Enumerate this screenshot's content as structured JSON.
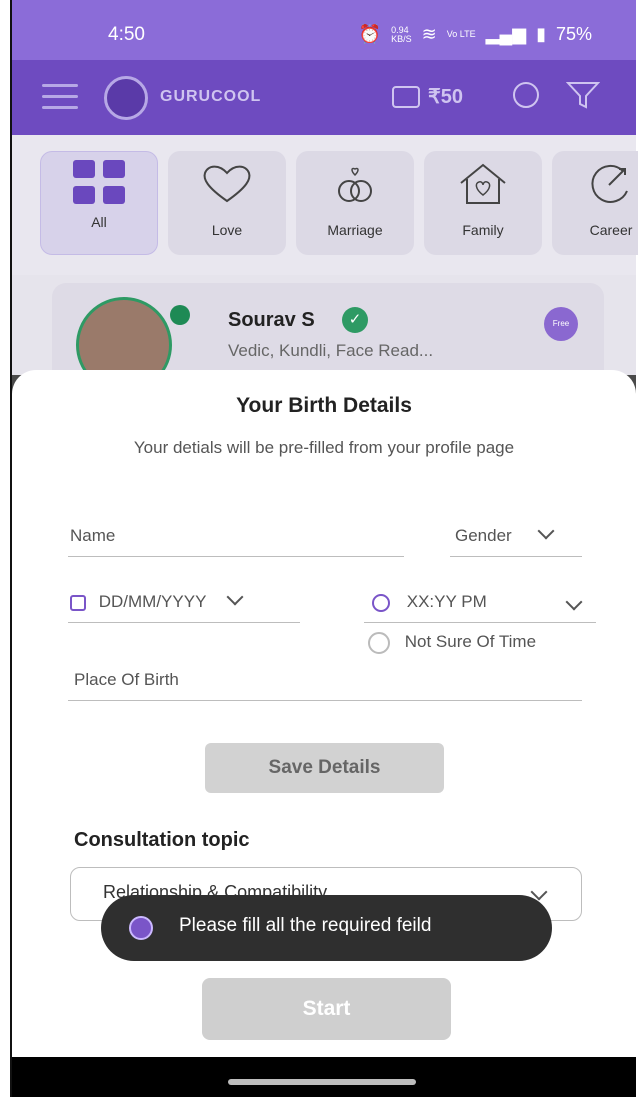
{
  "status_bar": {
    "time": "4:50",
    "net_speed_value": "0.94",
    "net_speed_unit": "KB/S",
    "volte": "Vo LTE",
    "battery": "75%"
  },
  "header": {
    "brand": "GURUCOOL",
    "wallet_amount": "₹50"
  },
  "categories": [
    {
      "label": "All",
      "icon": "grid-icon"
    },
    {
      "label": "Love",
      "icon": "heart-icon"
    },
    {
      "label": "Marriage",
      "icon": "rings-icon"
    },
    {
      "label": "Family",
      "icon": "house-icon"
    },
    {
      "label": "Career",
      "icon": "career-icon"
    }
  ],
  "astrologer_card": {
    "name": "Sourav S",
    "skills": "Vedic, Kundli, Face Read...",
    "badge": "Free"
  },
  "sheet": {
    "title": "Your Birth Details",
    "subtitle": "Your detials will be pre-filled from your profile page",
    "name_placeholder": "Name",
    "gender_placeholder": "Gender",
    "date_placeholder": "DD/MM/YYYY",
    "time_placeholder": "XX:YY PM",
    "not_sure_label": "Not Sure Of Time",
    "place_placeholder": "Place Of Birth",
    "save_label": "Save Details",
    "topic_heading": "Consultation topic",
    "topic_value": "Relationship & Compatibility",
    "start_label": "Start"
  },
  "toast": {
    "message": "Please fill all the required feild"
  },
  "colors": {
    "brand_purple": "#6e4bc0",
    "status_purple": "#8b6cd8",
    "accent": "#7a55c8",
    "disabled_button": "#d2d2d2"
  }
}
